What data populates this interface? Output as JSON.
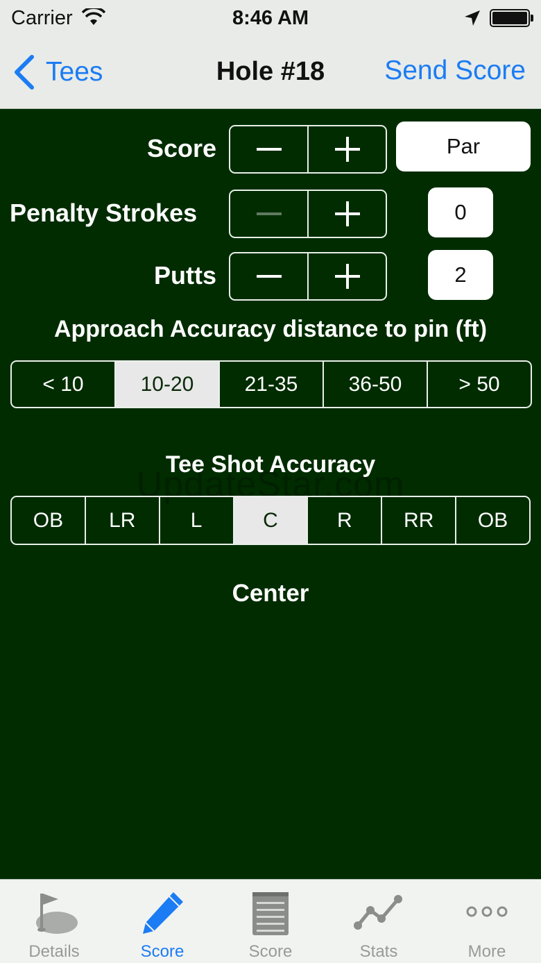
{
  "status": {
    "carrier": "Carrier",
    "time": "8:46 AM"
  },
  "nav": {
    "back_label": "Tees",
    "title": "Hole #18",
    "action_label": "Send Score"
  },
  "rows": {
    "score": {
      "label": "Score",
      "value": "Par"
    },
    "penalty": {
      "label": "Penalty Strokes",
      "value": "0"
    },
    "putts": {
      "label": "Putts",
      "value": "2"
    }
  },
  "approach": {
    "title": "Approach Accuracy distance to pin (ft)",
    "options": [
      "< 10",
      "10-20",
      "21-35",
      "36-50",
      "> 50"
    ],
    "selected": "10-20"
  },
  "tee_shot": {
    "title": "Tee Shot Accuracy",
    "options": [
      "OB",
      "LR",
      "L",
      "C",
      "R",
      "RR",
      "OB"
    ],
    "selected": "C",
    "status_text": "Center"
  },
  "watermark": "UpdateStar.com",
  "tabbar": {
    "tabs": [
      {
        "label": "Details",
        "icon": "golf-flag-icon"
      },
      {
        "label": "Score",
        "icon": "pencil-icon",
        "active": true
      },
      {
        "label": "Score",
        "icon": "notepad-icon"
      },
      {
        "label": "Stats",
        "icon": "line-graph-icon"
      },
      {
        "label": "More",
        "icon": "more-dots-icon"
      }
    ]
  },
  "colors": {
    "background": "#002c00",
    "accent": "#1b7cf3",
    "selected_segment": "#e8e8e8"
  }
}
